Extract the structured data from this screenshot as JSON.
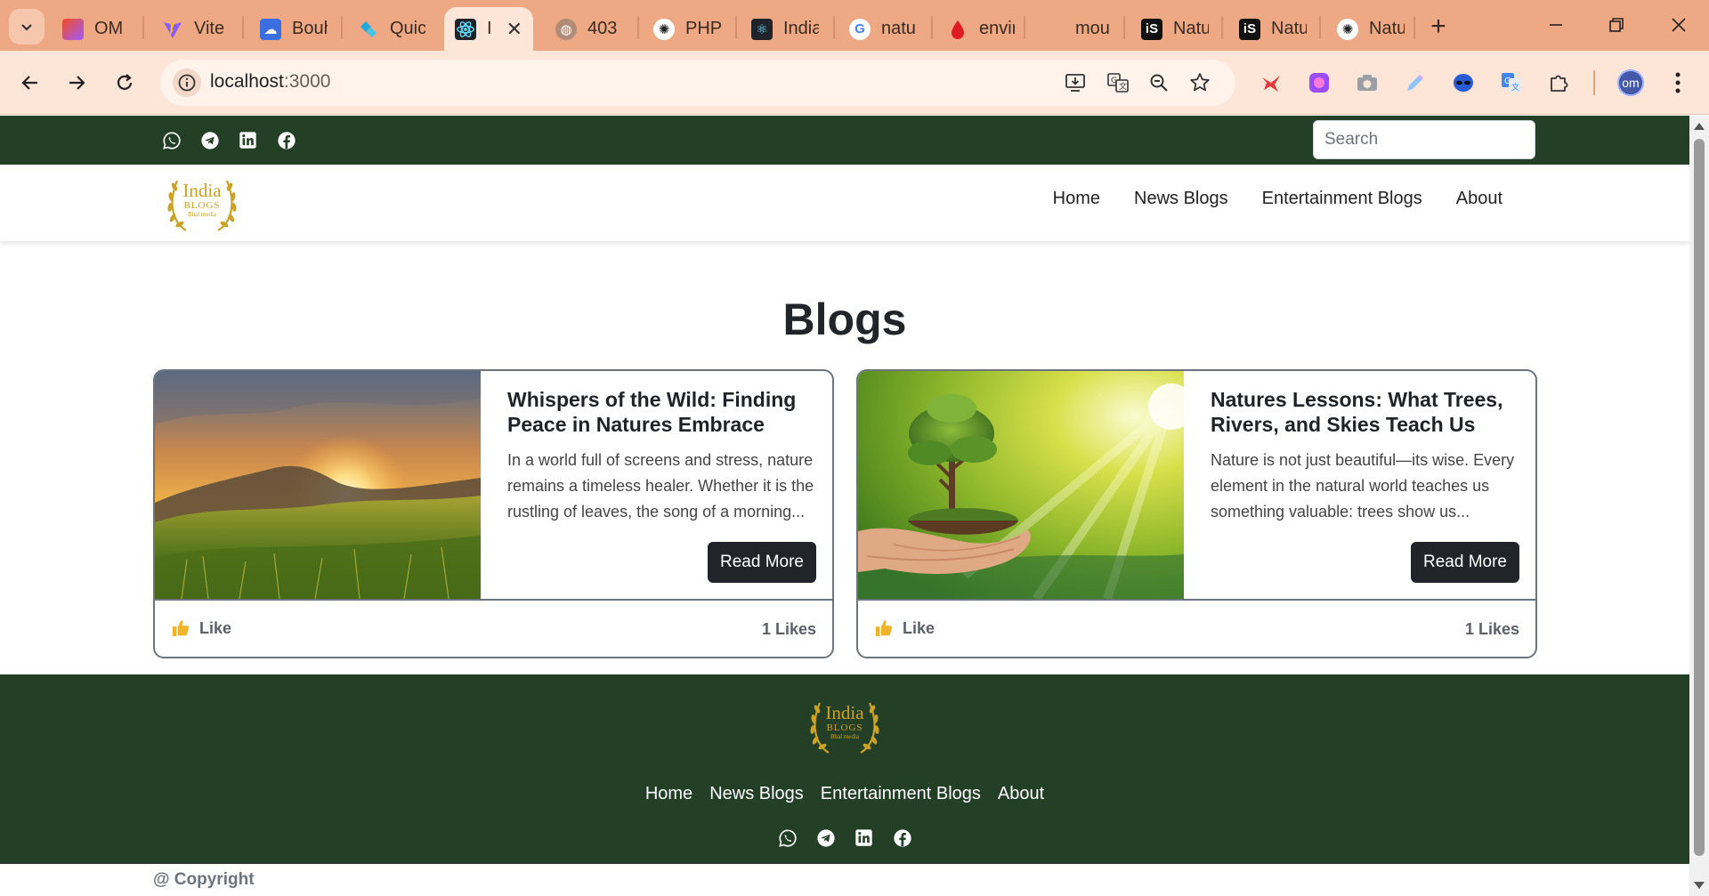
{
  "browser": {
    "tabs": [
      {
        "label": "OM",
        "icon": "figma-icon"
      },
      {
        "label": "Vite",
        "icon": "vite-icon"
      },
      {
        "label": "Bouh",
        "icon": "cloud-icon"
      },
      {
        "label": "Quic",
        "icon": "puzzle-icon"
      },
      {
        "label": "I",
        "icon": "react-icon",
        "active": true
      },
      {
        "label": "403",
        "icon": "globe-icon"
      },
      {
        "label": "PHP",
        "icon": "openai-icon"
      },
      {
        "label": "India",
        "icon": "react-icon"
      },
      {
        "label": "natu",
        "icon": "google-icon"
      },
      {
        "label": "envir",
        "icon": "drop-icon"
      },
      {
        "label": "mou",
        "icon": "blank-icon"
      },
      {
        "label": "Natu",
        "icon": "is-icon"
      },
      {
        "label": "Natu",
        "icon": "is-icon"
      },
      {
        "label": "Natu",
        "icon": "openai-icon"
      }
    ],
    "url_host": "localhost",
    "url_port": ":3000",
    "profile_initials": "om"
  },
  "site": {
    "logo_line1": "India",
    "logo_line2": "BLOGS",
    "logo_line3": "Bhal media",
    "search_placeholder": "Search",
    "nav": [
      "Home",
      "News Blogs",
      "Entertainment Blogs",
      "About"
    ],
    "page_title": "Blogs"
  },
  "cards": [
    {
      "title": "Whispers of the Wild: Finding Peace in Natures Embrace",
      "excerpt": "In a world full of screens and stress, nature remains a timeless healer. Whether it is the rustling of leaves, the song of a morning...",
      "read_more": "Read More",
      "like_label": "Like",
      "likes": "1 Likes"
    },
    {
      "title": "Natures Lessons: What Trees, Rivers, and Skies Teach Us",
      "excerpt": "Nature is not just beautiful—its wise. Every element in the natural world teaches us something valuable: trees show us...",
      "read_more": "Read More",
      "like_label": "Like",
      "likes": "1 Likes"
    }
  ],
  "footer": {
    "links": [
      "Home",
      "News Blogs",
      "Entertainment Blogs",
      "About"
    ],
    "copyright": "@ Copyright"
  },
  "colors": {
    "brand_green": "#233f26",
    "gold": "#c9a227",
    "dark_button": "#212529",
    "chrome_tabbar": "#eea883",
    "chrome_toolbar": "#fde5d8"
  }
}
